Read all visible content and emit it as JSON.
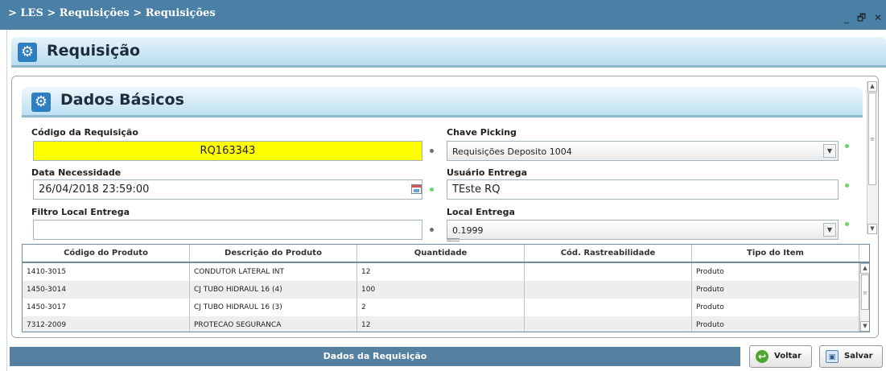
{
  "titlebar": {
    "breadcrumb": "> LES > Requisições > Requisições",
    "window_controls": "_ 🗗 ✕"
  },
  "panel": {
    "title": "Requisição",
    "icon": "gear-icon"
  },
  "section": {
    "title": "Dados Básicos",
    "icon": "gear-icon"
  },
  "form": {
    "codigo_requisicao": {
      "label": "Código da Requisição",
      "value": "RQ163343",
      "highlight_color": "#ffff00"
    },
    "chave_picking": {
      "label": "Chave Picking",
      "value": "Requisições Deposito 1004"
    },
    "data_necessidade": {
      "label": "Data Necessidade",
      "value": "26/04/2018 23:59:00"
    },
    "usuario_entrega": {
      "label": "Usuário Entrega",
      "value": "TEste RQ"
    },
    "filtro_local_entrega": {
      "label": "Filtro Local Entrega",
      "value": ""
    },
    "local_entrega": {
      "label": "Local Entrega",
      "value": "0.1999"
    }
  },
  "grid": {
    "columns": [
      "Código do Produto",
      "Descrição do Produto",
      "Quantidade",
      "Cód. Rastreabilidade",
      "Tipo do Item"
    ],
    "rows": [
      [
        "1410-3015",
        "CONDUTOR LATERAL INT",
        "12",
        "",
        "Produto"
      ],
      [
        "1450-3014",
        "CJ TUBO HIDRAUL 16 (4)",
        "100",
        "",
        "Produto"
      ],
      [
        "1450-3017",
        "CJ TUBO HIDRAUL 16 (3)",
        "2",
        "",
        "Produto"
      ],
      [
        "7312-2009",
        "PROTECAO SEGURANCA",
        "12",
        "",
        "Produto"
      ]
    ]
  },
  "footer": {
    "tab_label": "Dados da Requisição",
    "back_label": "Voltar",
    "save_label": "Salvar"
  },
  "colors": {
    "titlebar": "#4a7fa6",
    "header_accent": "#bde0f2",
    "footer_bar": "#55809f"
  }
}
